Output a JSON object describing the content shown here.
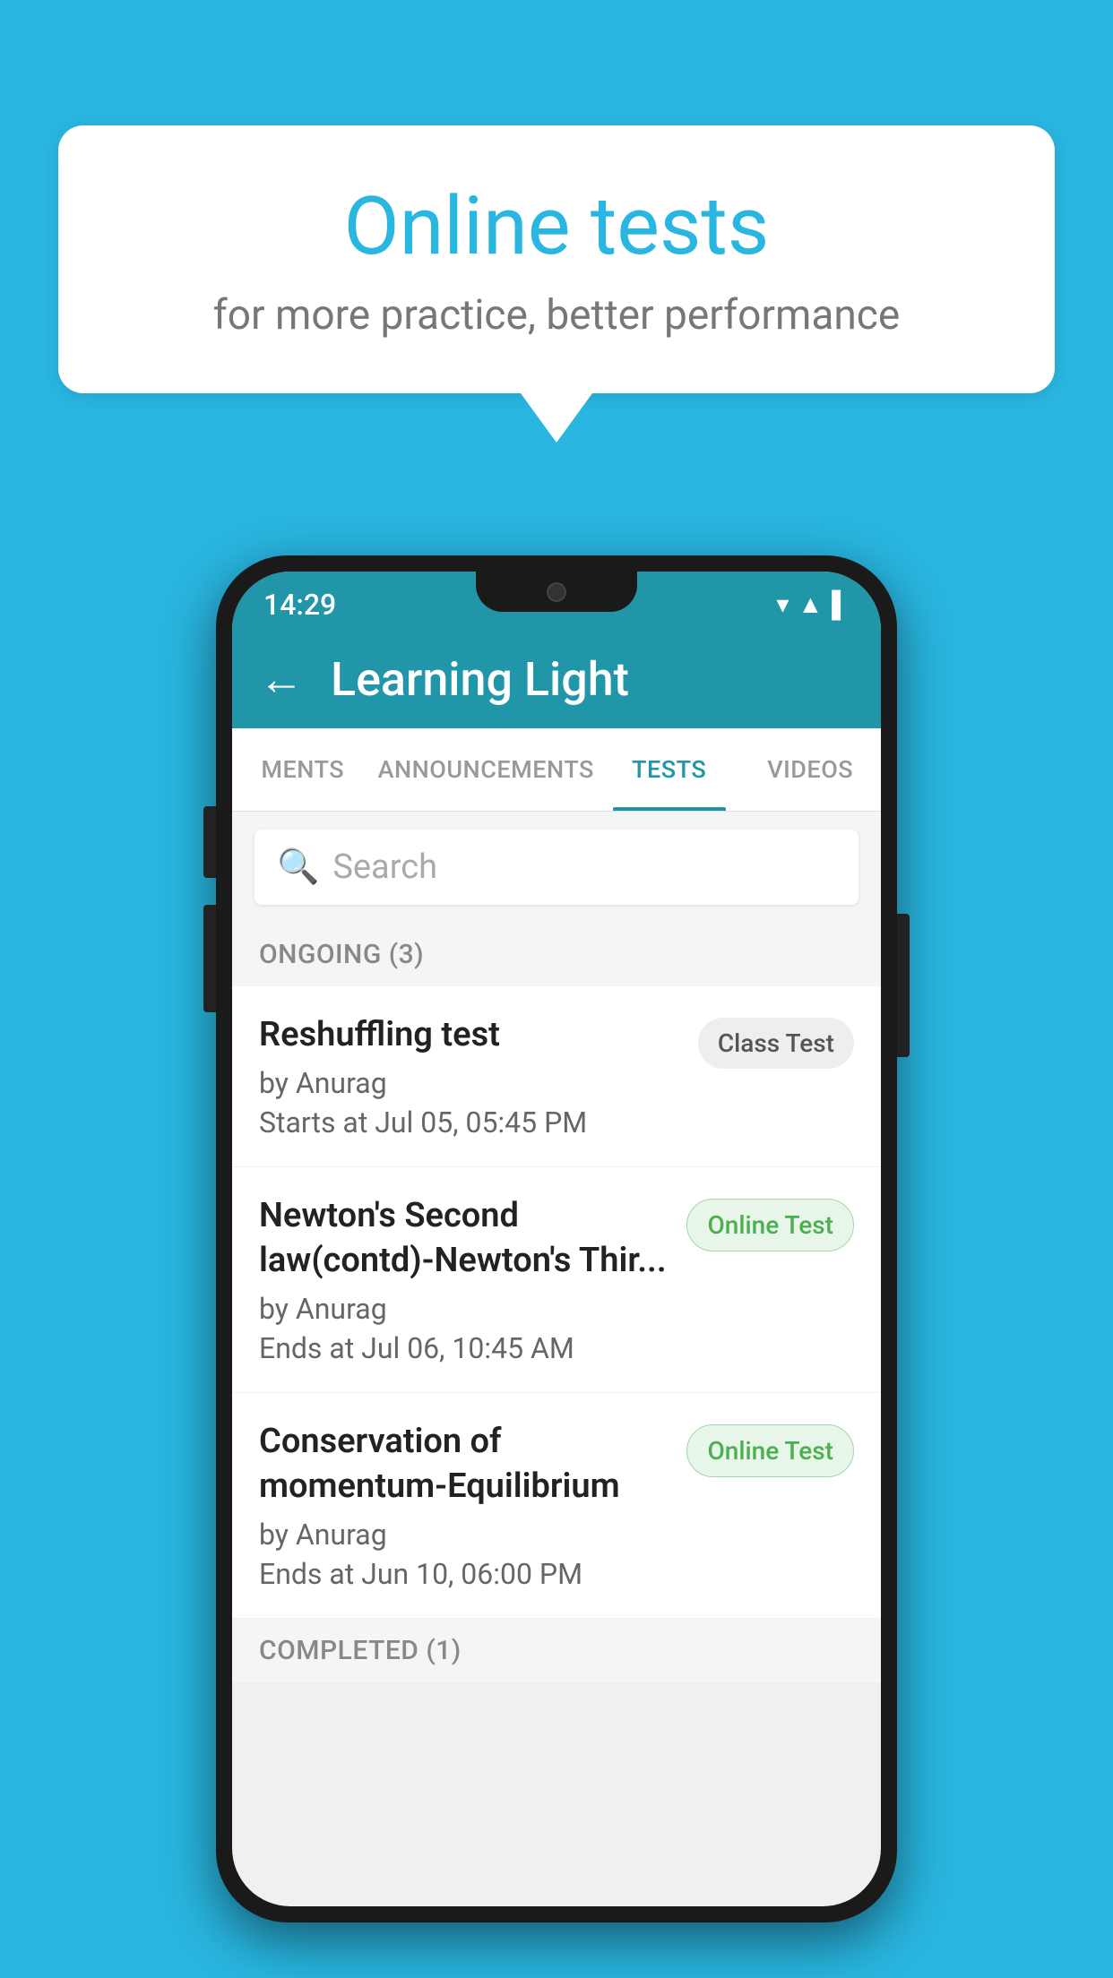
{
  "background_color": "#29b6e0",
  "speech_bubble": {
    "title": "Online tests",
    "subtitle": "for more practice, better performance"
  },
  "phone": {
    "status_bar": {
      "time": "14:29",
      "icons": [
        "wifi",
        "signal",
        "battery"
      ]
    },
    "app_bar": {
      "back_label": "←",
      "title": "Learning Light"
    },
    "tabs": [
      {
        "label": "MENTS",
        "active": false
      },
      {
        "label": "ANNOUNCEMENTS",
        "active": false
      },
      {
        "label": "TESTS",
        "active": true
      },
      {
        "label": "VIDEOS",
        "active": false
      }
    ],
    "search": {
      "placeholder": "Search"
    },
    "sections": [
      {
        "header": "ONGOING (3)",
        "items": [
          {
            "name": "Reshuffling test",
            "author": "by Anurag",
            "time_label": "Starts at",
            "time": "Jul 05, 05:45 PM",
            "badge": "Class Test",
            "badge_type": "class"
          },
          {
            "name": "Newton's Second law(contd)-Newton's Thir...",
            "author": "by Anurag",
            "time_label": "Ends at",
            "time": "Jul 06, 10:45 AM",
            "badge": "Online Test",
            "badge_type": "online"
          },
          {
            "name": "Conservation of momentum-Equilibrium",
            "author": "by Anurag",
            "time_label": "Ends at",
            "time": "Jun 10, 06:00 PM",
            "badge": "Online Test",
            "badge_type": "online"
          }
        ]
      }
    ],
    "completed_label": "COMPLETED (1)"
  }
}
